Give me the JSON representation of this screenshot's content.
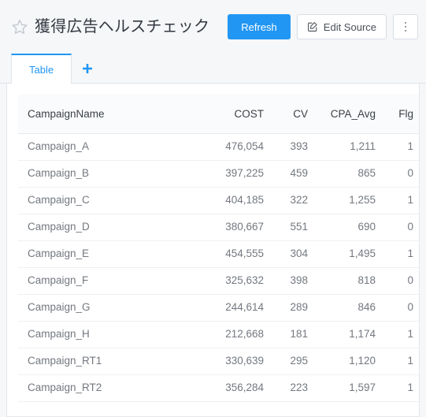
{
  "header": {
    "title": "獲得広告ヘルスチェック",
    "star_icon": "star-outline-icon",
    "refresh_label": "Refresh",
    "edit_source_label": "Edit Source",
    "edit_source_icon": "pencil-square-icon",
    "more_menu_icon": "kebab-menu-icon",
    "accent_color": "#2196f3"
  },
  "tabs": {
    "items": [
      {
        "label": "Table",
        "active": true
      }
    ],
    "add_tab_icon": "plus-icon"
  },
  "table": {
    "columns": [
      {
        "key": "CampaignName",
        "label": "CampaignName",
        "align": "left"
      },
      {
        "key": "COST",
        "label": "COST",
        "align": "right"
      },
      {
        "key": "CV",
        "label": "CV",
        "align": "right"
      },
      {
        "key": "CPA_Avg",
        "label": "CPA_Avg",
        "align": "right"
      },
      {
        "key": "Flg",
        "label": "Flg",
        "align": "right"
      }
    ],
    "rows": [
      {
        "CampaignName": "Campaign_A",
        "COST": "476,054",
        "CV": "393",
        "CPA_Avg": "1,211",
        "Flg": "1"
      },
      {
        "CampaignName": "Campaign_B",
        "COST": "397,225",
        "CV": "459",
        "CPA_Avg": "865",
        "Flg": "0"
      },
      {
        "CampaignName": "Campaign_C",
        "COST": "404,185",
        "CV": "322",
        "CPA_Avg": "1,255",
        "Flg": "1"
      },
      {
        "CampaignName": "Campaign_D",
        "COST": "380,667",
        "CV": "551",
        "CPA_Avg": "690",
        "Flg": "0"
      },
      {
        "CampaignName": "Campaign_E",
        "COST": "454,555",
        "CV": "304",
        "CPA_Avg": "1,495",
        "Flg": "1"
      },
      {
        "CampaignName": "Campaign_F",
        "COST": "325,632",
        "CV": "398",
        "CPA_Avg": "818",
        "Flg": "0"
      },
      {
        "CampaignName": "Campaign_G",
        "COST": "244,614",
        "CV": "289",
        "CPA_Avg": "846",
        "Flg": "0"
      },
      {
        "CampaignName": "Campaign_H",
        "COST": "212,668",
        "CV": "181",
        "CPA_Avg": "1,174",
        "Flg": "1"
      },
      {
        "CampaignName": "Campaign_RT1",
        "COST": "330,639",
        "CV": "295",
        "CPA_Avg": "1,120",
        "Flg": "1"
      },
      {
        "CampaignName": "Campaign_RT2",
        "COST": "356,284",
        "CV": "223",
        "CPA_Avg": "1,597",
        "Flg": "1"
      }
    ]
  }
}
